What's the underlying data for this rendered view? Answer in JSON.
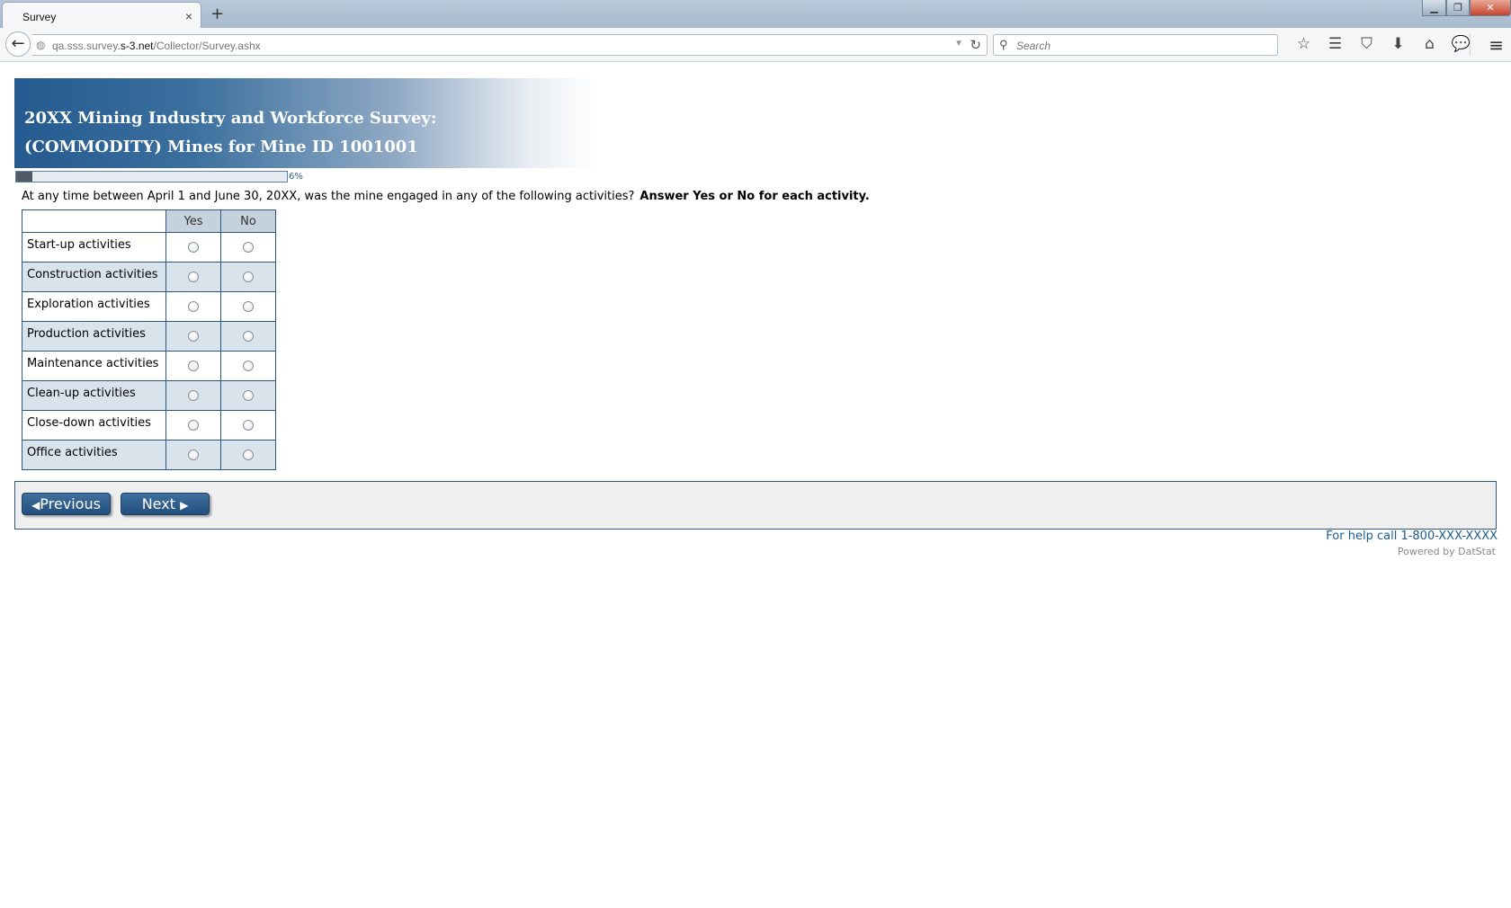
{
  "browser": {
    "tab_title": "Survey",
    "tab_close": "×",
    "new_tab": "+",
    "window_controls": {
      "minimize": "▁",
      "maximize": "❐",
      "close": "✕"
    },
    "url_prefix": "qa.sss.survey.",
    "url_host": "s-3.net",
    "url_path": "/Collector/Survey.ashx",
    "search_placeholder": "Search",
    "toolbar_icons": [
      "star-icon",
      "reading-list-icon",
      "pocket-icon",
      "download-icon",
      "home-icon",
      "chat-icon"
    ],
    "glyphs": {
      "back": "←",
      "globe": "◍",
      "dropdown": "▼",
      "reload": "↻",
      "search": "⚲",
      "star": "☆",
      "reading_list": "☰",
      "pocket": "⛉",
      "download": "⬇",
      "home": "⌂",
      "chat": "💬",
      "menu": "≡"
    }
  },
  "survey": {
    "title_line1": "20XX Mining Industry and Workforce Survey:",
    "title_line2": "(COMMODITY) Mines for Mine ID 1001001",
    "progress_percent": 6,
    "progress_label": "6%",
    "question_text": "At any time between April 1 and June 30, 20XX, was the mine engaged in any of the following activities?",
    "question_instruction": "Answer Yes or No for each activity.",
    "columns": [
      "Yes",
      "No"
    ],
    "rows": [
      "Start-up activities",
      "Construction activities",
      "Exploration activities",
      "Production activities",
      "Maintenance activities",
      "Clean-up activities",
      "Close-down activities",
      "Office activities"
    ]
  },
  "navigation": {
    "previous_label": "Previous",
    "next_label": "Next",
    "previous_glyph": "◀",
    "next_glyph": "▶"
  },
  "footer": {
    "help_text": "For help call 1-800-XXX-XXXX",
    "powered_text": "Powered by DatStat"
  },
  "colors": {
    "accent": "#245a8f",
    "table_border": "#2c5880",
    "row_alt": "#d9e3ec",
    "header_cell": "#c5d1dc"
  }
}
